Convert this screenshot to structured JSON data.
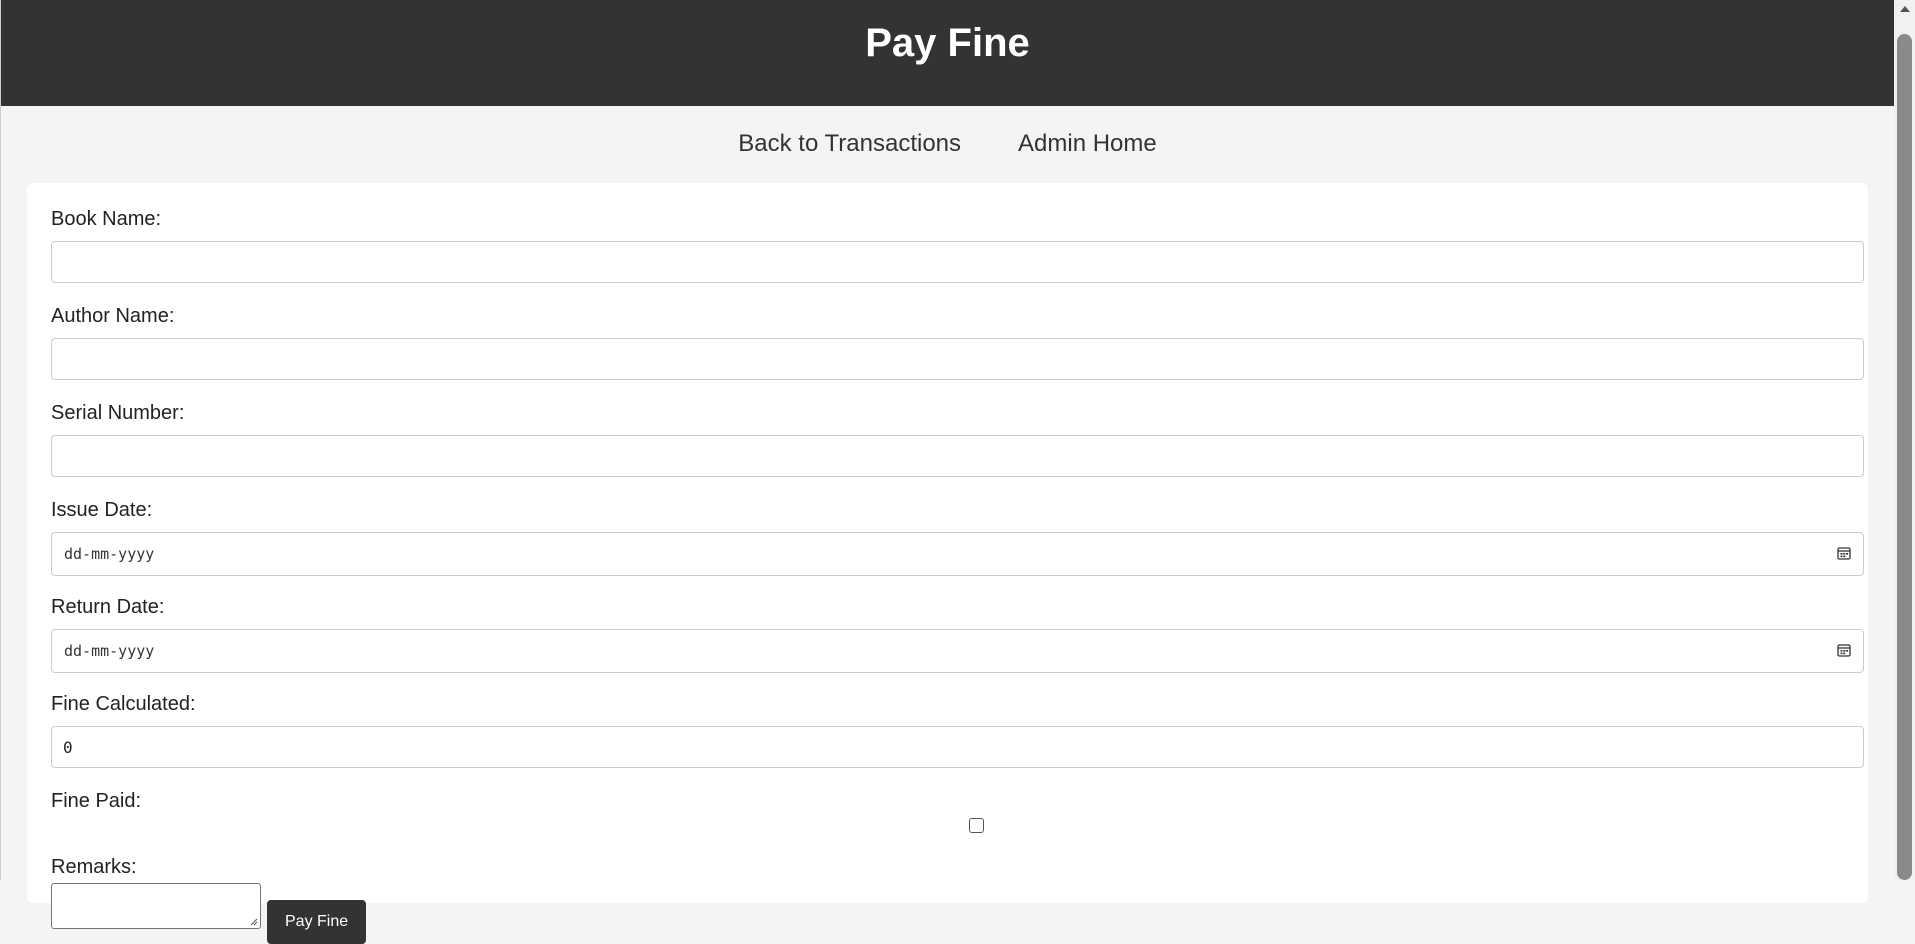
{
  "header": {
    "title": "Pay Fine"
  },
  "nav": {
    "links": [
      {
        "label": "Back to Transactions"
      },
      {
        "label": "Admin Home"
      }
    ]
  },
  "form": {
    "book_name": {
      "label": "Book Name:",
      "value": ""
    },
    "author_name": {
      "label": "Author Name:",
      "value": ""
    },
    "serial_number": {
      "label": "Serial Number:",
      "value": ""
    },
    "issue_date": {
      "label": "Issue Date:",
      "placeholder": "dd-mm-yyyy"
    },
    "return_date": {
      "label": "Return Date:",
      "placeholder": "dd-mm-yyyy"
    },
    "fine_calculated": {
      "label": "Fine Calculated:",
      "value": "0"
    },
    "fine_paid": {
      "label": "Fine Paid:",
      "checked": false
    },
    "remarks": {
      "label": "Remarks:",
      "value": ""
    },
    "submit_label": "Pay Fine"
  },
  "icons": {
    "date_picker": "calendar-icon",
    "resize": "resize-grip-icon"
  },
  "colors": {
    "header_bg": "#333333",
    "page_bg": "#f4f4f4",
    "card_bg": "#ffffff",
    "button_bg": "#333333"
  }
}
